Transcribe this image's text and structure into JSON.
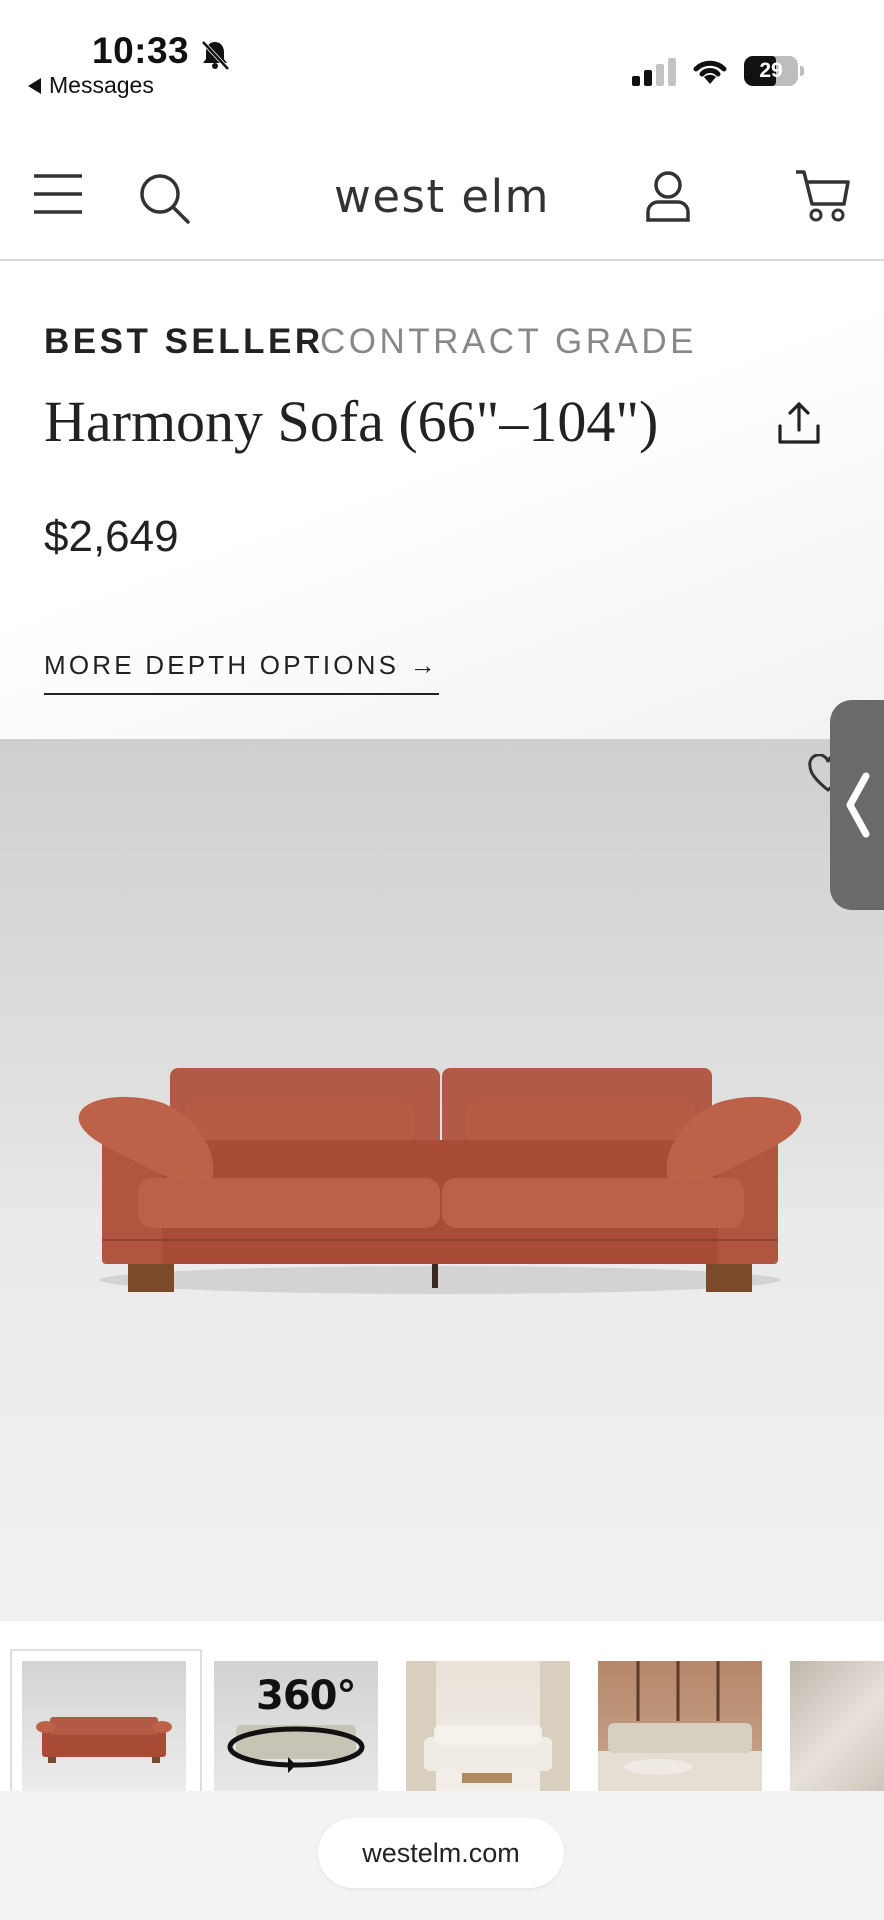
{
  "status_bar": {
    "time": "10:33",
    "back_app": "Messages",
    "battery_level": "29",
    "icons": [
      "bell-muted-icon",
      "signal-icon",
      "wifi-icon",
      "battery-icon"
    ]
  },
  "header": {
    "logo": "west elm",
    "icons": [
      "hamburger-menu-icon",
      "search-icon",
      "account-icon",
      "cart-icon"
    ]
  },
  "product": {
    "badges": [
      "BEST SELLER",
      "CONTRACT GRADE"
    ],
    "title": "Harmony Sofa (66\"–104\")",
    "price": "$2,649",
    "depth_link": "MORE DEPTH OPTIONS →"
  },
  "gallery": {
    "thumbnails": [
      "sofa-front-thumb",
      "sofa-360-thumb",
      "living-room-white-sofa-thumb",
      "living-room-beige-sofa-thumb",
      "fabric-closeup-thumb"
    ],
    "badge_360": "360°"
  },
  "browser": {
    "url": "westelm.com"
  },
  "colors": {
    "sofa": "#b5553f",
    "legs": "#7a4a2a",
    "handle": "#6a6a6a"
  }
}
